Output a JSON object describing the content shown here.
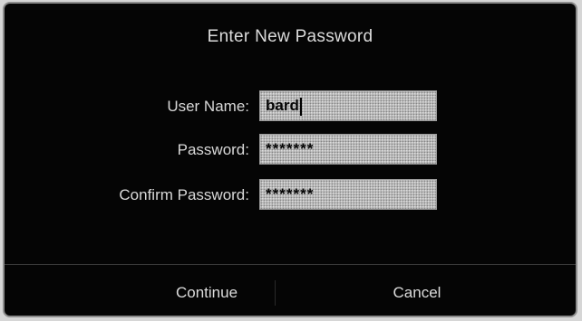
{
  "dialog": {
    "title": "Enter New Password"
  },
  "form": {
    "username": {
      "label": "User Name:",
      "value": "bard"
    },
    "password": {
      "label": "Password:",
      "value": "*******"
    },
    "confirm_password": {
      "label": "Confirm Password:",
      "value": "*******"
    }
  },
  "buttons": {
    "continue_label": "Continue",
    "cancel_label": "Cancel"
  },
  "colors": {
    "background": "#050505",
    "text": "#dcdcdc",
    "field_fill": "#bdbdbd"
  }
}
